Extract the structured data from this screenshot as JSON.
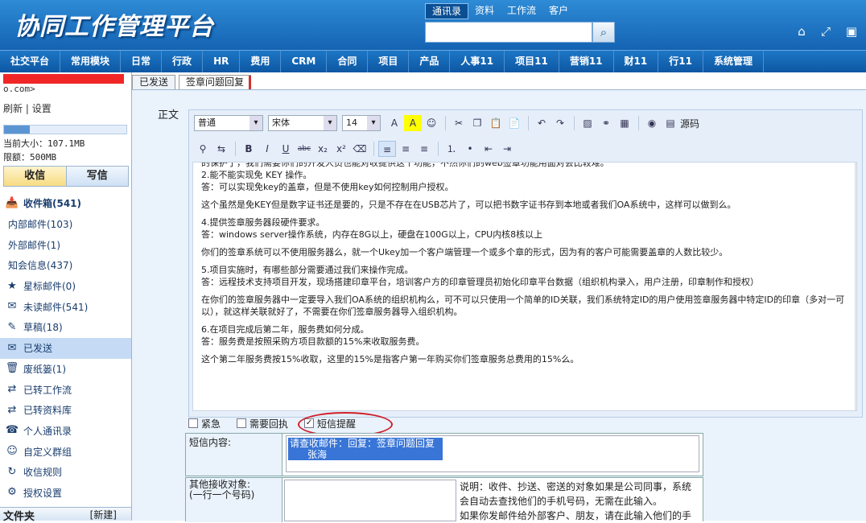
{
  "header": {
    "logo": "协同工作管理平台",
    "topnav": [
      "通讯录",
      "资料",
      "工作流",
      "客户"
    ],
    "search_icon": "search-icon"
  },
  "menu": [
    "社交平台",
    "常用模块",
    "日常",
    "行政",
    "HR",
    "费用",
    "CRM",
    "合同",
    "项目",
    "产品",
    "人事11",
    "项目11",
    "营销11",
    "财11",
    "行11",
    "系统管理"
  ],
  "sidebar": {
    "account_tail": "o.com>",
    "refresh": "刷新",
    "settings": "设置",
    "quota_fraction": 0.21,
    "current_size": "当前大小：107.1MB",
    "limit": "限额：500MB",
    "receive": "收信",
    "compose": "写信",
    "folders": [
      {
        "label": "收件箱(541)",
        "icon": "📥",
        "cls": "bold"
      },
      {
        "label": "内部邮件(103)",
        "cls": "sub"
      },
      {
        "label": "外部邮件(1)",
        "cls": "sub"
      },
      {
        "label": "知会信息(437)",
        "cls": "sub"
      },
      {
        "label": "星标邮件(0)",
        "icon": "★"
      },
      {
        "label": "未读邮件(541)",
        "icon": "✉"
      },
      {
        "label": "草稿(18)",
        "icon": "✎"
      },
      {
        "label": "已发送",
        "icon": "✉",
        "cls": "sel"
      },
      {
        "label": "废纸篓(1)",
        "icon": "🗑"
      },
      {
        "label": "已转工作流",
        "icon": "⇄"
      },
      {
        "label": "已转资料库",
        "icon": "⇄"
      },
      {
        "label": "个人通讯录",
        "icon": "☎"
      },
      {
        "label": "自定义群组",
        "icon": "☺"
      },
      {
        "label": "收信规则",
        "icon": "↻"
      },
      {
        "label": "授权设置",
        "icon": "⚙"
      }
    ],
    "file_section": "文件夹",
    "file_new": "[新建]"
  },
  "tabs": [
    "已发送",
    "签章问题回复"
  ],
  "compose": {
    "body_label": "正文",
    "toolbar": {
      "format": "普通",
      "font": "宋体",
      "size": "14",
      "source": "源码"
    },
    "content": [
      "的保护了，我们需要你们的开发人员也能对收提供这个功能，不然你们的web签章功能用面对会比较难。",
      "2.能不能实现免 KEY 操作。",
      "答：可以实现免key的盖章，但是不使用key如何控制用户授权。",
      "",
      "这个虽然是免KEY但是数字证书还是要的，只是不存在在USB芯片了，可以把书数字证书存到本地或者我们OA系统中，这样可以做到么。",
      "",
      "4.提供签章服务器段硬件要求。",
      "答：windows server操作系统，内存在8G以上，硬盘在100G以上，CPU内核8核以上",
      "",
      "你们的签章系统可以不使用服务器么，就一个Ukey加一个客户端管理一个或多个章的形式，因为有的客户可能需要盖章的人数比较少。",
      "",
      "5.项目实施时，有哪些部分需要通过我们来操作完成。",
      "答：远程技术支持项目开发，现场搭建印章平台，培训客户方的印章管理员初始化印章平台数据（组织机构录入，用户注册，印章制作和授权）",
      "",
      "在你们的签章服务器中一定要导入我们OA系统的组织机构么，可不可以只使用一个简单的ID关联，我们系统特定ID的用户使用签章服务器中特定ID的印章（多对一可以），就这样关联就好了，不需要在你们签章服务器导入组织机构。",
      "",
      "6.在项目完成后第二年，服务费如何分成。",
      "答：服务费是按照采购方项目款额的15%来收取服务费。",
      "",
      "这个第二年服务费按15%收取，这里的15%是指客户第一年购买你们签章服务总费用的15%么。"
    ],
    "options": {
      "urgent": "紧急",
      "reply_needed": "需要回执",
      "sms": "短信提醒"
    },
    "sms_label": "短信内容:",
    "sms_line1": "请查收邮件：回复：签章问题回复",
    "sms_line2": "张海",
    "other_label": "其他接收对象:",
    "other_hint": "(一行一个号码)",
    "note": [
      "说明：收件、抄送、密送的对象如果是公司同事，系统",
      "会自动去查找他们的手机号码，无需在此输入。",
      "如果你发邮件给外部客户、朋友，请在此输入他们的手"
    ]
  }
}
